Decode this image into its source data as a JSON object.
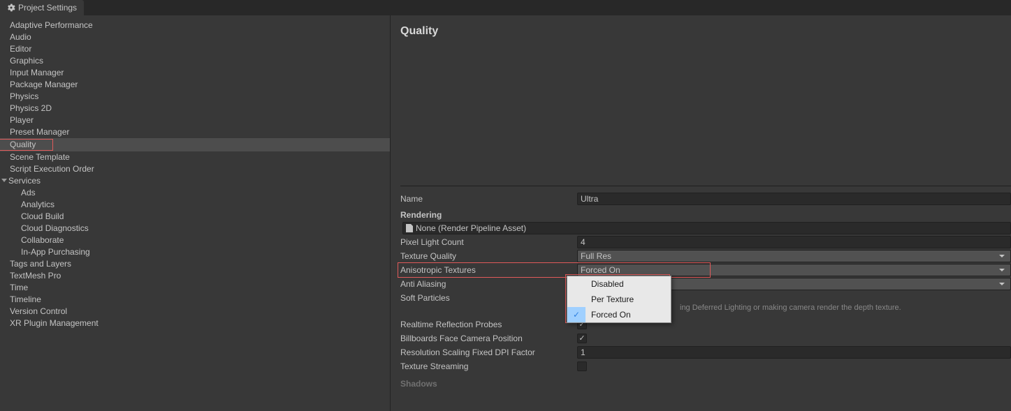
{
  "tab": {
    "title": "Project Settings"
  },
  "sidebar": {
    "items": [
      "Adaptive Performance",
      "Audio",
      "Editor",
      "Graphics",
      "Input Manager",
      "Package Manager",
      "Physics",
      "Physics 2D",
      "Player",
      "Preset Manager",
      "Quality",
      "Scene Template",
      "Script Execution Order",
      "Services",
      "Tags and Layers",
      "TextMesh Pro",
      "Time",
      "Timeline",
      "Version Control",
      "XR Plugin Management"
    ],
    "services_children": [
      "Ads",
      "Analytics",
      "Cloud Build",
      "Cloud Diagnostics",
      "Collaborate",
      "In-App Purchasing"
    ],
    "selected": "Quality"
  },
  "content": {
    "title": "Quality",
    "name_label": "Name",
    "name_value": "Ultra",
    "rendering_header": "Rendering",
    "render_pipeline_value": "None (Render Pipeline Asset)",
    "pixel_light_label": "Pixel Light Count",
    "pixel_light_value": "4",
    "texture_quality_label": "Texture Quality",
    "texture_quality_value": "Full Res",
    "anisotropic_label": "Anisotropic Textures",
    "anisotropic_value": "Forced On",
    "anti_aliasing_label": "Anti Aliasing",
    "soft_particles_label": "Soft Particles",
    "soft_particles_hint": "ing Deferred Lighting or making camera render the depth texture.",
    "realtime_reflection_label": "Realtime Reflection Probes",
    "billboards_label": "Billboards Face Camera Position",
    "resolution_scaling_label": "Resolution Scaling Fixed DPI Factor",
    "resolution_scaling_value": "1",
    "texture_streaming_label": "Texture Streaming",
    "shadows_header": "Shadows"
  },
  "popup": {
    "options": [
      "Disabled",
      "Per Texture",
      "Forced On"
    ],
    "selected_index": 2
  }
}
